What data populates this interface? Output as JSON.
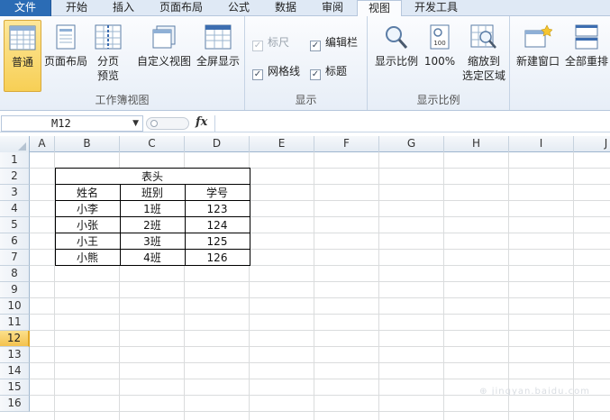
{
  "ribbon_tabs": [
    {
      "label": "文件"
    },
    {
      "label": "开始"
    },
    {
      "label": "插入"
    },
    {
      "label": "页面布局"
    },
    {
      "label": "公式"
    },
    {
      "label": "数据"
    },
    {
      "label": "审阅"
    },
    {
      "label": "视图"
    },
    {
      "label": "开发工具"
    }
  ],
  "workbook_views": {
    "group_label": "工作簿视图",
    "normal": "普通",
    "page_layout": "页面布局",
    "page_break_line1": "分页",
    "page_break_line2": "预览",
    "custom_views": "自定义视图",
    "full_screen": "全屏显示"
  },
  "show": {
    "group_label": "显示",
    "ruler": "标尺",
    "formula_bar": "编辑栏",
    "gridlines": "网格线",
    "headings": "标题"
  },
  "zoom": {
    "group_label": "显示比例",
    "zoom": "显示比例",
    "hundred": "100%",
    "zoom_sel_line1": "缩放到",
    "zoom_sel_line2": "选定区域"
  },
  "window": {
    "new_window": "新建窗口",
    "arrange_all": "全部重排"
  },
  "formula_bar": {
    "name_box": "M12",
    "fx": "fx",
    "formula": ""
  },
  "columns": [
    "A",
    "B",
    "C",
    "D",
    "E",
    "F",
    "G",
    "H",
    "I",
    "J"
  ],
  "rows": [
    "1",
    "2",
    "3",
    "4",
    "5",
    "6",
    "7",
    "8",
    "9",
    "10",
    "11",
    "12",
    "13",
    "14",
    "15",
    "16"
  ],
  "active_row": "12",
  "table": {
    "title": "表头",
    "headers": [
      "姓名",
      "班别",
      "学号"
    ],
    "rows": [
      [
        "小李",
        "1班",
        "123"
      ],
      [
        "小张",
        "2班",
        "124"
      ],
      [
        "小王",
        "3班",
        "125"
      ],
      [
        "小熊",
        "4班",
        "126"
      ]
    ]
  },
  "colors": {
    "file_tab": "#2b6cb5",
    "selected_button": "#f7cf55",
    "active_row_header": "#f4c24e"
  }
}
